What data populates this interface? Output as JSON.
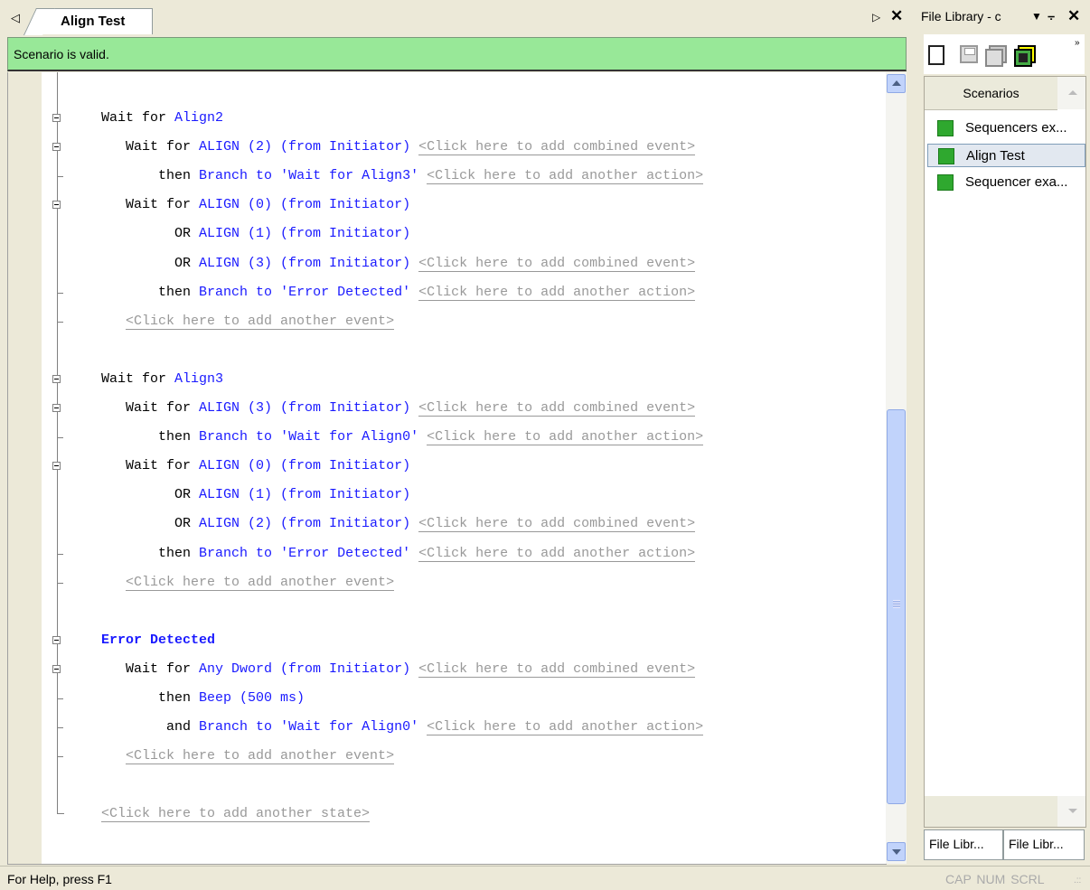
{
  "editor": {
    "tab_label": "Align Test",
    "status_message": "Scenario is valid."
  },
  "code_lines": [
    {
      "segs": [
        [
          "k",
          "Wait for "
        ],
        [
          "b",
          "Align2"
        ]
      ]
    },
    {
      "segs": [
        [
          "k",
          "   Wait for "
        ],
        [
          "b",
          "ALIGN (2) (from Initiator)"
        ],
        [
          "k",
          " "
        ],
        [
          "h",
          "<Click here to add combined event>"
        ]
      ]
    },
    {
      "segs": [
        [
          "k",
          "       then "
        ],
        [
          "b",
          "Branch to"
        ],
        [
          "k",
          " "
        ],
        [
          "b",
          "'Wait for Align3'"
        ],
        [
          "k",
          " "
        ],
        [
          "h",
          "<Click here to add another action>"
        ]
      ]
    },
    {
      "segs": [
        [
          "k",
          "   Wait for "
        ],
        [
          "b",
          "ALIGN (0) (from Initiator)"
        ]
      ]
    },
    {
      "segs": [
        [
          "k",
          "         OR "
        ],
        [
          "b",
          "ALIGN (1) (from Initiator)"
        ]
      ]
    },
    {
      "segs": [
        [
          "k",
          "         OR "
        ],
        [
          "b",
          "ALIGN (3) (from Initiator)"
        ],
        [
          "k",
          " "
        ],
        [
          "h",
          "<Click here to add combined event>"
        ]
      ]
    },
    {
      "segs": [
        [
          "k",
          "       then "
        ],
        [
          "b",
          "Branch to"
        ],
        [
          "k",
          " "
        ],
        [
          "b",
          "'Error Detected'"
        ],
        [
          "k",
          " "
        ],
        [
          "h",
          "<Click here to add another action>"
        ]
      ]
    },
    {
      "segs": [
        [
          "k",
          "   "
        ],
        [
          "h",
          "<Click here to add another event>"
        ]
      ]
    },
    {
      "segs": []
    },
    {
      "segs": [
        [
          "k",
          "Wait for "
        ],
        [
          "b",
          "Align3"
        ]
      ]
    },
    {
      "segs": [
        [
          "k",
          "   Wait for "
        ],
        [
          "b",
          "ALIGN (3) (from Initiator)"
        ],
        [
          "k",
          " "
        ],
        [
          "h",
          "<Click here to add combined event>"
        ]
      ]
    },
    {
      "segs": [
        [
          "k",
          "       then "
        ],
        [
          "b",
          "Branch to"
        ],
        [
          "k",
          " "
        ],
        [
          "b",
          "'Wait for Align0'"
        ],
        [
          "k",
          " "
        ],
        [
          "h",
          "<Click here to add another action>"
        ]
      ]
    },
    {
      "segs": [
        [
          "k",
          "   Wait for "
        ],
        [
          "b",
          "ALIGN (0) (from Initiator)"
        ]
      ]
    },
    {
      "segs": [
        [
          "k",
          "         OR "
        ],
        [
          "b",
          "ALIGN (1) (from Initiator)"
        ]
      ]
    },
    {
      "segs": [
        [
          "k",
          "         OR "
        ],
        [
          "b",
          "ALIGN (2) (from Initiator)"
        ],
        [
          "k",
          " "
        ],
        [
          "h",
          "<Click here to add combined event>"
        ]
      ]
    },
    {
      "segs": [
        [
          "k",
          "       then "
        ],
        [
          "b",
          "Branch to"
        ],
        [
          "k",
          " "
        ],
        [
          "b",
          "'Error Detected'"
        ],
        [
          "k",
          " "
        ],
        [
          "h",
          "<Click here to add another action>"
        ]
      ]
    },
    {
      "segs": [
        [
          "k",
          "   "
        ],
        [
          "h",
          "<Click here to add another event>"
        ]
      ]
    },
    {
      "segs": []
    },
    {
      "segs": [
        [
          "hb",
          "Error Detected"
        ]
      ]
    },
    {
      "segs": [
        [
          "k",
          "   Wait for "
        ],
        [
          "b",
          "Any Dword (from Initiator)"
        ],
        [
          "k",
          " "
        ],
        [
          "h",
          "<Click here to add combined event>"
        ]
      ]
    },
    {
      "segs": [
        [
          "k",
          "       then "
        ],
        [
          "b",
          "Beep (500 ms)"
        ]
      ]
    },
    {
      "segs": [
        [
          "k",
          "        and "
        ],
        [
          "b",
          "Branch to"
        ],
        [
          "k",
          " "
        ],
        [
          "b",
          "'Wait for Align0'"
        ],
        [
          "k",
          " "
        ],
        [
          "h",
          "<Click here to add another action>"
        ]
      ]
    },
    {
      "segs": [
        [
          "k",
          "   "
        ],
        [
          "h",
          "<Click here to add another event>"
        ]
      ]
    },
    {
      "segs": []
    },
    {
      "segs": [
        [
          "h",
          "<Click here to add another state>"
        ]
      ]
    }
  ],
  "right_panel": {
    "title": "File Library - c",
    "list_header": "Scenarios",
    "items": [
      {
        "label": "Sequencers ex...",
        "selected": false
      },
      {
        "label": "Align Test",
        "selected": true
      },
      {
        "label": "Sequencer exa...",
        "selected": false
      }
    ],
    "bottom_tabs": [
      "File Libr...",
      "File Libr..."
    ]
  },
  "statusbar": {
    "help_text": "For Help, press F1",
    "indicators": "CAP  NUM  SCRL"
  }
}
